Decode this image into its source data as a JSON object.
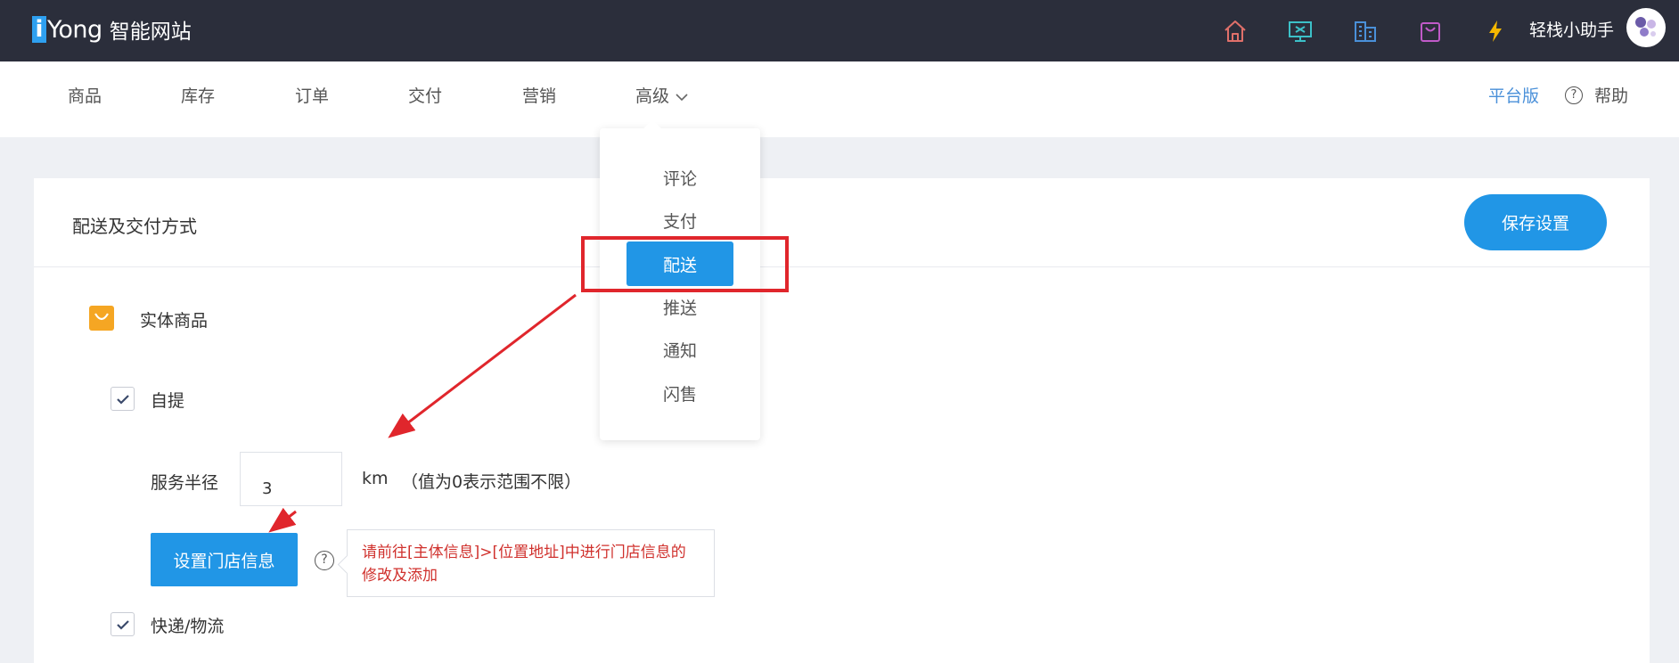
{
  "topbar": {
    "logo_i": "i",
    "logo_brand": "Yong",
    "logo_sub": "智能网站",
    "icons": [
      "home-icon",
      "monitor-icon",
      "building-icon",
      "shopping-bag-icon",
      "lightning-icon"
    ],
    "assistant": "轻栈小助手"
  },
  "nav": {
    "items": [
      "商品",
      "库存",
      "订单",
      "交付",
      "营销",
      "高级"
    ],
    "platform": "平台版",
    "help_symbol": "?",
    "help": "帮助"
  },
  "dropdown": {
    "items": [
      "评论",
      "支付",
      "配送",
      "推送",
      "通知",
      "闪售"
    ],
    "active": "配送"
  },
  "card": {
    "title": "配送及交付方式",
    "save_label": "保存设置",
    "goods_label": "实体商品",
    "self_pickup": {
      "label": "自提",
      "checked": true
    },
    "radius_label": "服务半径",
    "radius_value": "3",
    "radius_unit": "km",
    "radius_hint": "（值为0表示范围不限）",
    "store_button": "设置门店信息",
    "question_symbol": "?",
    "tooltip": "请前往[主体信息]>[位置地址]中进行门店信息的修改及添加",
    "express": {
      "label": "快递/物流",
      "checked": true
    }
  },
  "colors": {
    "topbar_bg": "#2b2e3b",
    "primary": "#2196e6",
    "annotation": "#e0262c",
    "goods_icon": "#f5a623",
    "tooltip_text": "#d0312d"
  }
}
